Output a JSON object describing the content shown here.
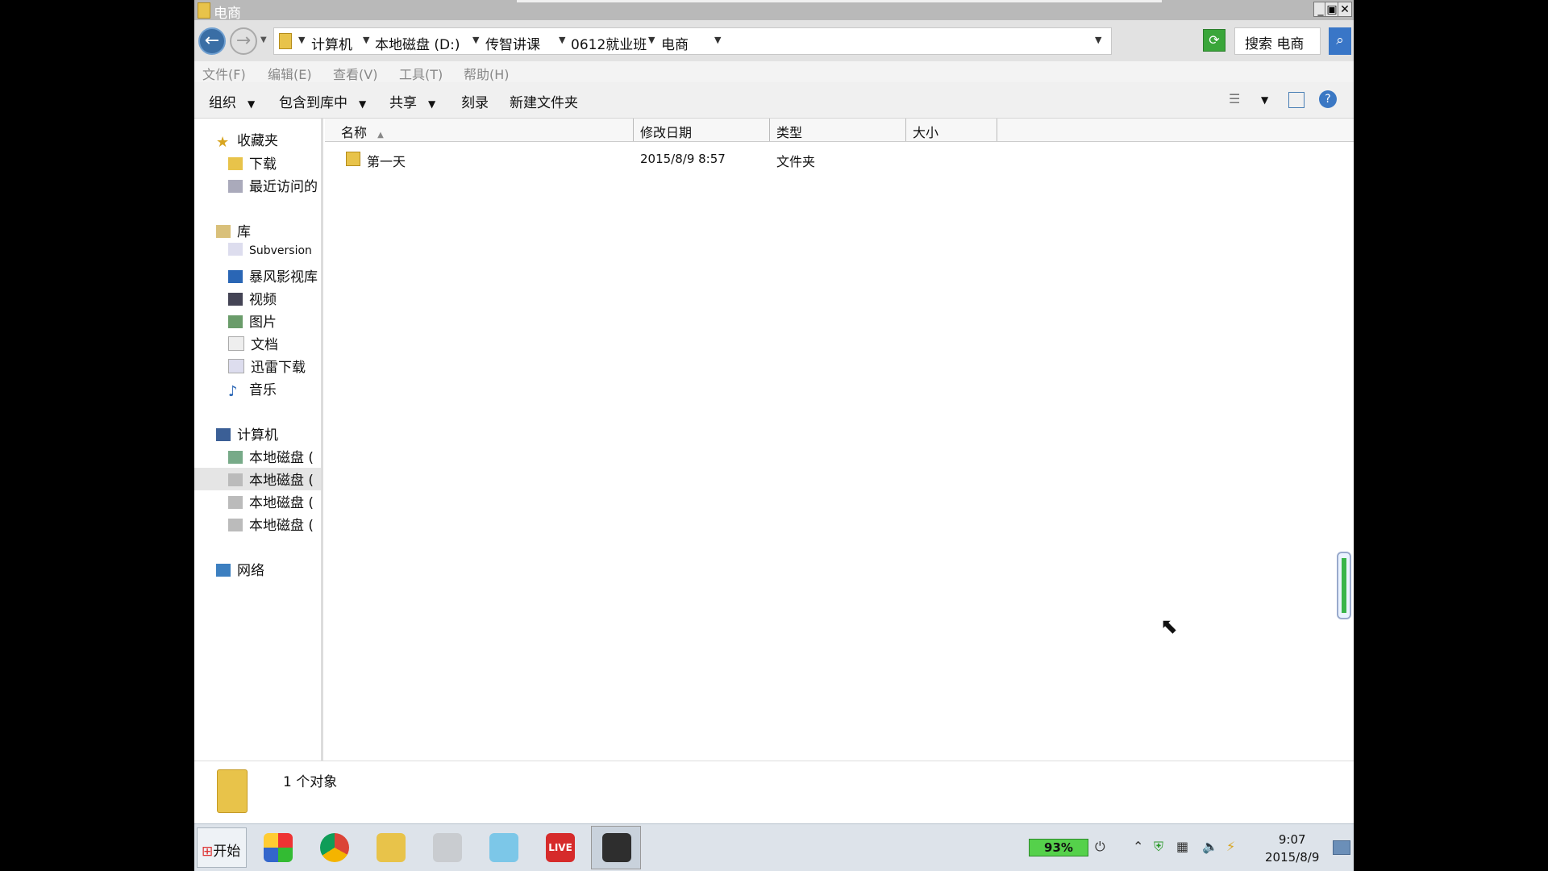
{
  "window": {
    "title": "电商"
  },
  "address": {
    "crumbs": [
      "计算机",
      "本地磁盘 (D:)",
      "传智讲课",
      "0612就业班",
      "电商"
    ],
    "search_placeholder": "搜索 电商"
  },
  "menu": [
    "文件(F)",
    "编辑(E)",
    "查看(V)",
    "工具(T)",
    "帮助(H)"
  ],
  "commands": {
    "organize": "组织",
    "include": "包含到库中",
    "share": "共享",
    "burn": "刻录",
    "new_folder": "新建文件夹"
  },
  "nav": {
    "favorites": {
      "label": "收藏夹",
      "items": [
        "下载",
        "最近访问的"
      ]
    },
    "libraries": {
      "label": "库",
      "items": [
        "Subversion",
        "暴风影视库",
        "视频",
        "图片",
        "文档",
        "迅雷下载",
        "音乐"
      ]
    },
    "computer": {
      "label": "计算机",
      "items": [
        "本地磁盘 (",
        "本地磁盘 (",
        "本地磁盘 (",
        "本地磁盘 ("
      ]
    },
    "network": {
      "label": "网络"
    }
  },
  "columns": [
    "名称",
    "修改日期",
    "类型",
    "大小"
  ],
  "rows": [
    {
      "name": "第一天",
      "modified": "2015/8/9 8:57",
      "type": "文件夹",
      "size": ""
    }
  ],
  "status": {
    "text": "1 个对象"
  },
  "taskbar": {
    "start": "开始",
    "apps": [
      {
        "icon": "os-logo-icon",
        "glyph": ""
      },
      {
        "icon": "chrome-icon",
        "glyph": ""
      },
      {
        "icon": "explorer-icon",
        "glyph": ""
      },
      {
        "icon": "tools-icon",
        "glyph": ""
      },
      {
        "icon": "handshake-icon",
        "glyph": ""
      },
      {
        "icon": "live-icon",
        "glyph": "LIVE"
      },
      {
        "icon": "camcorder-icon",
        "glyph": ""
      }
    ],
    "battery": "93%",
    "time": "9:07",
    "date": "2015/8/9"
  },
  "colors": {
    "accent": "#3a6ea5",
    "folder": "#e8c34a",
    "battery": "#55d14b"
  }
}
